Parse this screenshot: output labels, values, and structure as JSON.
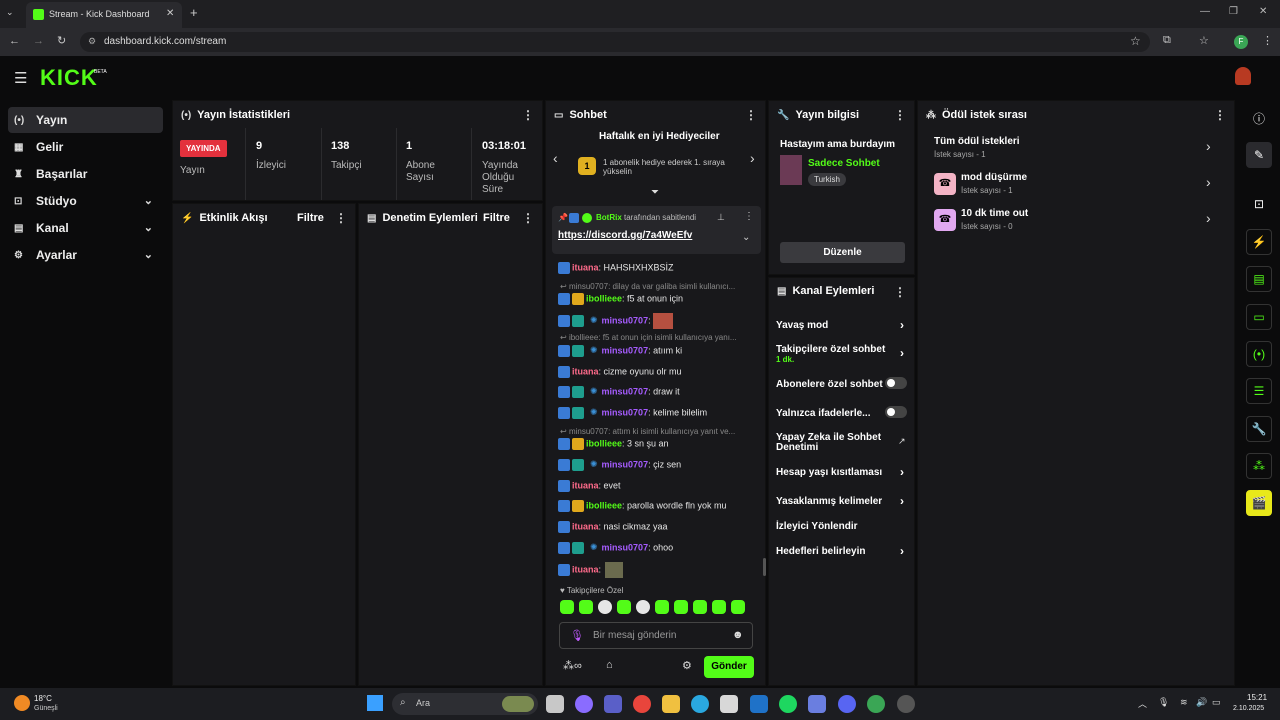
{
  "browser": {
    "tab_title": "Stream - Kick Dashboard",
    "url": "dashboard.kick.com/stream",
    "profile_initial": "F"
  },
  "app": {
    "logo": "KICK",
    "logo_tag": "BETA"
  },
  "sidebar": {
    "items": [
      {
        "label": "Yayın",
        "icon": "broadcast-icon"
      },
      {
        "label": "Gelir",
        "icon": "revenue-icon"
      },
      {
        "label": "Başarılar",
        "icon": "trophy-icon"
      },
      {
        "label": "Stüdyo",
        "icon": "studio-icon"
      },
      {
        "label": "Kanal",
        "icon": "channel-icon"
      },
      {
        "label": "Ayarlar",
        "icon": "gear-icon"
      }
    ]
  },
  "stats": {
    "title": "Yayın İstatistikleri",
    "live_badge": "YAYINDA",
    "live_label": "Yayın",
    "items": [
      {
        "value": "9",
        "label": "İzleyici"
      },
      {
        "value": "138",
        "label": "Takipçi"
      },
      {
        "value": "1",
        "label": "Abone Sayısı"
      },
      {
        "value": "03:18:01",
        "label": "Yayında Olduğu Süre"
      }
    ]
  },
  "activity": {
    "title": "Etkinlik Akışı",
    "filter": "Filtre"
  },
  "moderation": {
    "title": "Denetim Eylemleri",
    "filter": "Filtre"
  },
  "chat": {
    "title": "Sohbet",
    "gifters_title": "Haftalık en iyi Hediyeciler",
    "gifter_text": "1 abonelik hediye ederek 1. sıraya yükselin",
    "gifter_rank": "1",
    "pinned_by": "BotRix",
    "pinned_suffix": "tarafından sabitlendi",
    "pinned_link": "https://discord.gg/7a4WeEfv",
    "messages": [
      {
        "user": "ituana",
        "text": ": HAHSHXHXBSİZ"
      },
      {
        "reply": "minsu0707: dilay da var galiba isimli kullanıcı..."
      },
      {
        "user": "ibollieee",
        "text": ": f5 at onun için"
      },
      {
        "user": "minsu0707",
        "text": ":"
      },
      {
        "reply": "ibollieee: f5 at onun için isimli kullanıcıya yanı..."
      },
      {
        "user": "minsu0707",
        "text": ": atıım ki"
      },
      {
        "user": "ituana",
        "text": ": cizme oyunu olr mu"
      },
      {
        "user": "minsu0707",
        "text": ": draw it"
      },
      {
        "user": "minsu0707",
        "text": ": kelime bilelim"
      },
      {
        "reply": "minsu0707: attım ki isimli kullanıcıya yanıt ve..."
      },
      {
        "user": "ibollieee",
        "text": ": 3 sn şu an"
      },
      {
        "user": "minsu0707",
        "text": ": çiz sen"
      },
      {
        "user": "ituana",
        "text": ": evet"
      },
      {
        "user": "ibollieee",
        "text": ": parolla wordle fln yok mu"
      },
      {
        "user": "ituana",
        "text": ": nasi cikmaz yaa"
      },
      {
        "user": "minsu0707",
        "text": ": ohoo"
      },
      {
        "user": "ituana",
        "text": ":"
      }
    ],
    "followers_only": "Takipçilere Özel",
    "input_placeholder": "Bir mesaj gönderin",
    "send": "Gönder"
  },
  "stream_info": {
    "title": "Yayın bilgisi",
    "stream_title": "Hastayım ama burdayım",
    "category": "Sadece Sohbet",
    "tag": "Turkish",
    "edit": "Düzenle"
  },
  "channel_actions": {
    "title": "Kanal Eylemleri",
    "rows": [
      {
        "label": "Yavaş mod"
      },
      {
        "label": "Takipçilere özel sohbet",
        "sub": "1 dk."
      },
      {
        "label": "Abonelere özel sohbet"
      },
      {
        "label": "Yalnızca ifadelerle..."
      },
      {
        "label": "Yapay Zeka ile Sohbet Denetimi"
      },
      {
        "label": "Hesap yaşı kısıtlaması"
      },
      {
        "label": "Yasaklanmış kelimeler"
      },
      {
        "label": "İzleyici Yönlendir"
      },
      {
        "label": "Hedefleri belirleyin"
      }
    ]
  },
  "rewards": {
    "title": "Ödül istek sırası",
    "items": [
      {
        "label": "Tüm ödül istekleri",
        "sub": "İstek sayısı - 1"
      },
      {
        "label": "mod düşürme",
        "sub": "İstek sayısı - 1"
      },
      {
        "label": "10 dk time out",
        "sub": "İstek sayısı - 0"
      }
    ]
  },
  "taskbar": {
    "weather_temp": "18°C",
    "weather_text": "Güneşli",
    "search": "Ara",
    "time": "15:21",
    "date": "2.10.2025"
  },
  "colors": {
    "accent": "#53fc18",
    "panel": "#18181b",
    "live": "#e3313d"
  }
}
